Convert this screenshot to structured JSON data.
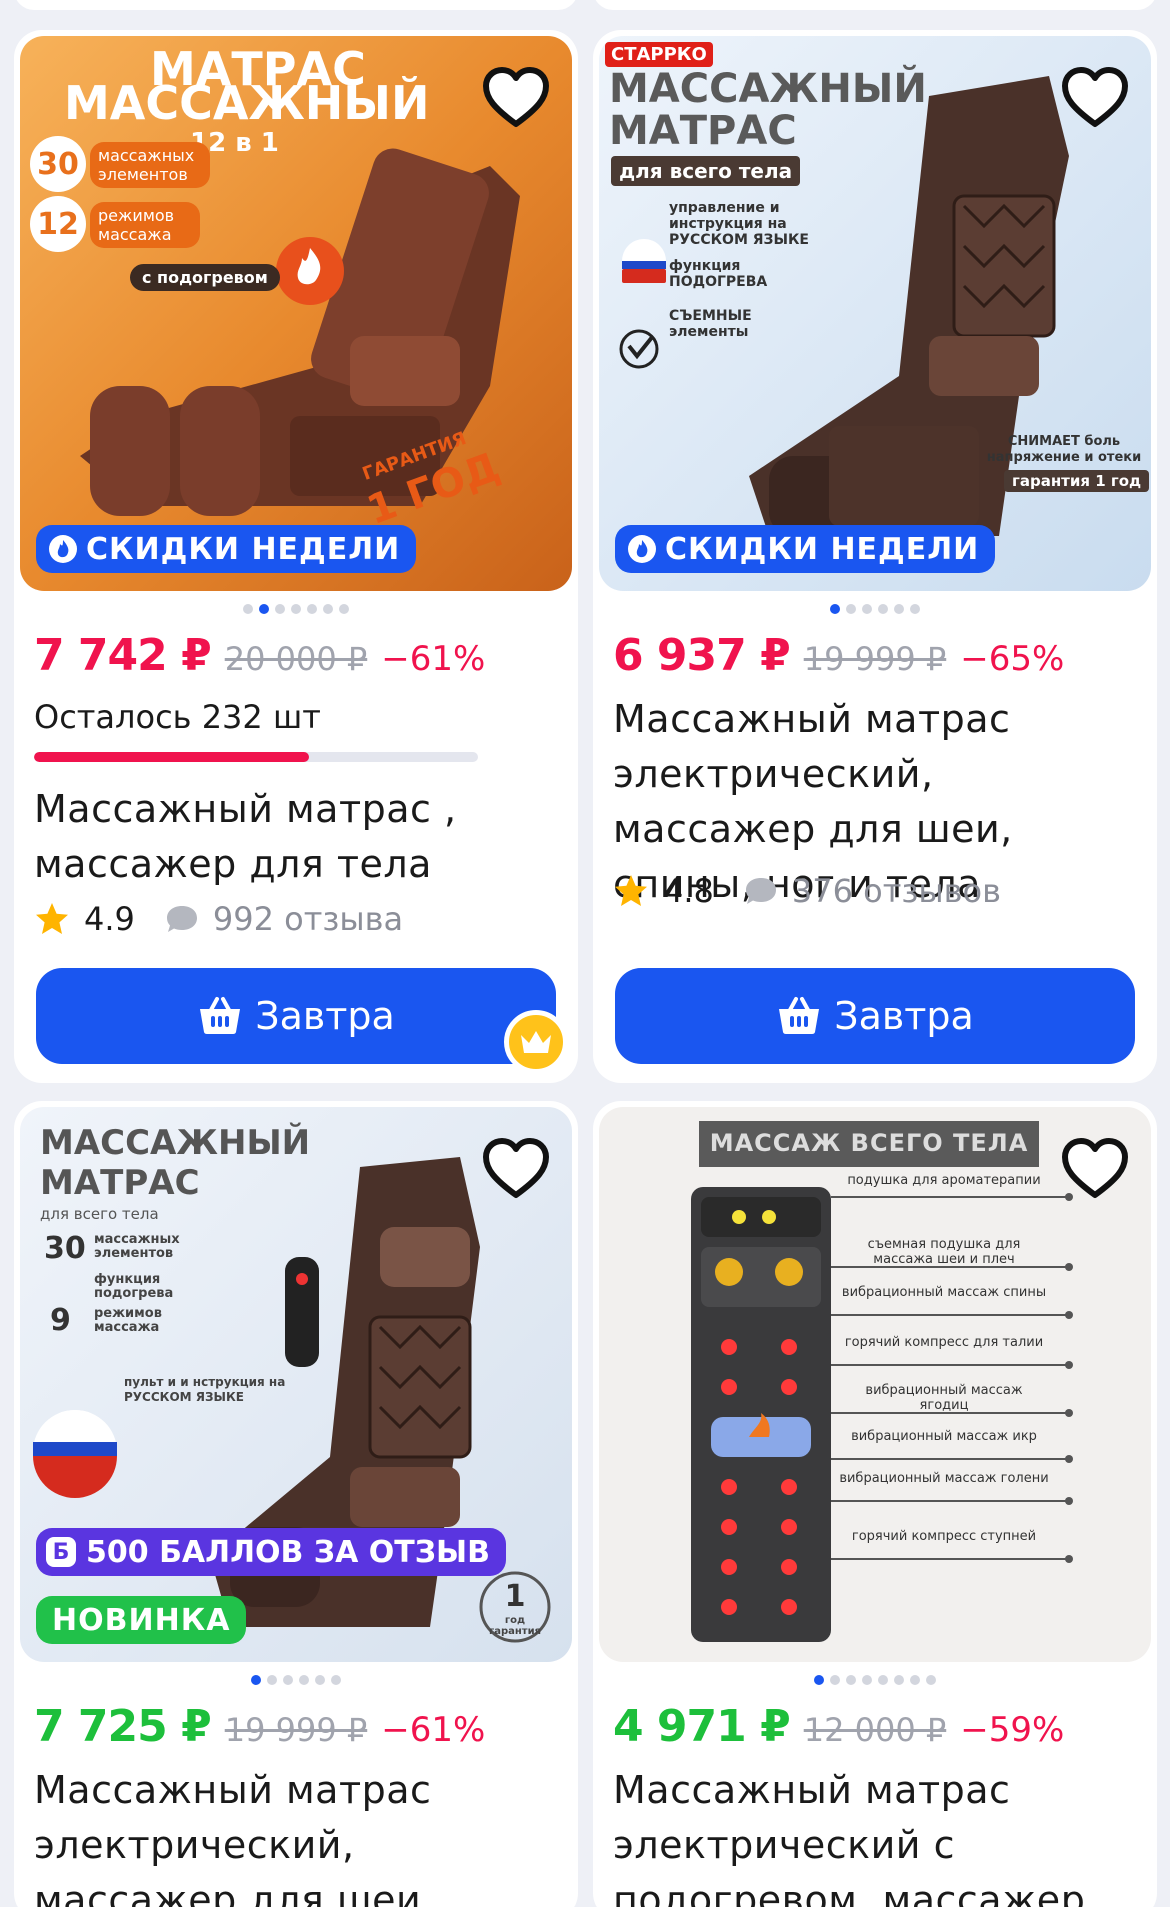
{
  "products": [
    {
      "image_text": {
        "title_line1": "МАТРАС",
        "title_line2": "МАССАЖНЫЙ",
        "subtitle": "12 в 1",
        "feature1_num": "30",
        "feature1_text": "массажных элементов",
        "feature2_num": "12",
        "feature2_text": "режимов массажа",
        "heating": "с подогревом",
        "warranty_label": "ГАРАНТИЯ",
        "warranty_value": "1 ГОД"
      },
      "promo_badge": "СКИДКИ НЕДЕЛИ",
      "dots_total": 7,
      "dot_active": 1,
      "price": "7 742 ₽",
      "old_price": "20 000 ₽",
      "discount": "−61%",
      "stock_text": "Осталось 232 шт",
      "stock_fraction": 0.62,
      "title": "Массажный матрас , массажер для тела",
      "rating": "4.9",
      "reviews": "992 отзыва",
      "button_label": "Завтра",
      "has_crown": true
    },
    {
      "image_text": {
        "brand": "СТАРРКО",
        "title_line1": "МАССАЖНЫЙ",
        "title_line2": "МАТРАС",
        "tag": "для всего тела",
        "feature1": "управление и инструкция на РУССКОМ ЯЗЫКЕ",
        "feature2": "функция ПОДОГРЕВА",
        "feature3": "СЪЕМНЫЕ элементы",
        "relief": "СНИМАЕТ боль напряжение и отеки",
        "warranty": "гарантия 1 год"
      },
      "promo_badge": "СКИДКИ НЕДЕЛИ",
      "dots_total": 6,
      "dot_active": 0,
      "price": "6 937 ₽",
      "old_price": "19 999 ₽",
      "discount": "−65%",
      "title": "Массажный матрас электрический, массажер для шеи, спины, ног и тела",
      "rating": "4.8",
      "reviews": "376 отзывов",
      "button_label": "Завтра",
      "has_crown": false
    },
    {
      "image_text": {
        "title_line1": "МАССАЖНЫЙ",
        "title_line2": "МАТРАС",
        "tag": "для всего тела",
        "feature1_num": "30",
        "feature1_text": "массажных элементов",
        "feature2_text": "функция подогрева",
        "feature3_num": "9",
        "feature3_text": "режимов массажа",
        "remote_text": "пульт и и нструкция на РУССКОМ ЯЗЫКЕ",
        "warranty_num": "1",
        "warranty_text": "год гарантия"
      },
      "bonus_badge": "500 БАЛЛОВ ЗА ОТЗЫВ",
      "bonus_letter": "Б",
      "new_badge": "НОВИНКА",
      "dots_total": 6,
      "dot_active": 0,
      "price": "7 725 ₽",
      "old_price": "19 999 ₽",
      "discount": "−61%",
      "title": "Массажный матрас электрический, массажер для шеи, спины, ног и тела"
    },
    {
      "image_text": {
        "header": "МАССАЖ ВСЕГО ТЕЛА",
        "labels": [
          "подушка для ароматерапии",
          "съемная подушка для массажа шеи и плеч",
          "вибрационный массаж спины",
          "горячий компресс для талии",
          "вибрационный массаж ягодиц",
          "вибрационный массаж икр",
          "вибрационный массаж голени",
          "горячий компресс ступней"
        ]
      },
      "dots_total": 8,
      "dot_active": 0,
      "price": "4 971 ₽",
      "old_price": "12 000 ₽",
      "discount": "−59%",
      "title": "Массажный матрас электрический с подогревом, массажер дл..."
    }
  ],
  "colors": {
    "accent_blue": "#1a56f0",
    "price_red": "#f0134d",
    "price_green": "#1dbf3b",
    "bonus_purple": "#5a35e0",
    "new_green": "#21c14a",
    "star": "#ffb400"
  },
  "icons": {
    "favorite": "heart-outline-icon",
    "promo": "fire-icon",
    "rating": "star-icon",
    "reviews": "chat-bubble-icon",
    "button": "basket-icon",
    "crown": "crown-icon"
  }
}
